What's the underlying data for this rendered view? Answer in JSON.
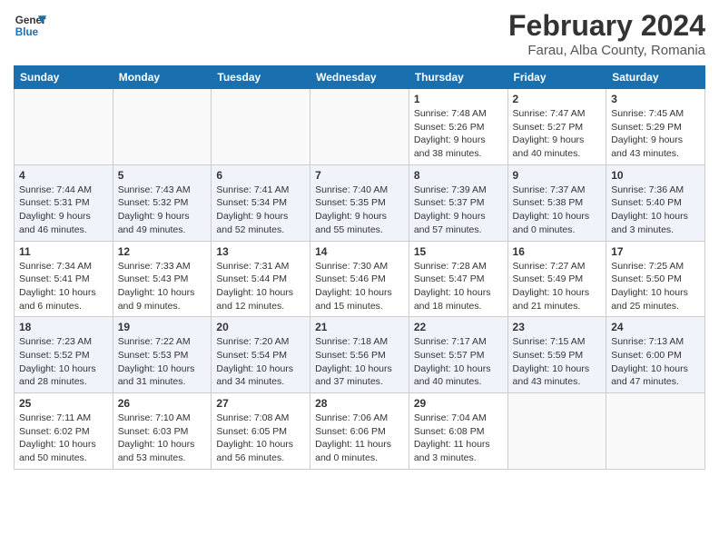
{
  "header": {
    "logo_line1": "General",
    "logo_line2": "Blue",
    "title": "February 2024",
    "subtitle": "Farau, Alba County, Romania"
  },
  "weekdays": [
    "Sunday",
    "Monday",
    "Tuesday",
    "Wednesday",
    "Thursday",
    "Friday",
    "Saturday"
  ],
  "weeks": [
    [
      {
        "num": "",
        "info": ""
      },
      {
        "num": "",
        "info": ""
      },
      {
        "num": "",
        "info": ""
      },
      {
        "num": "",
        "info": ""
      },
      {
        "num": "1",
        "info": "Sunrise: 7:48 AM\nSunset: 5:26 PM\nDaylight: 9 hours\nand 38 minutes."
      },
      {
        "num": "2",
        "info": "Sunrise: 7:47 AM\nSunset: 5:27 PM\nDaylight: 9 hours\nand 40 minutes."
      },
      {
        "num": "3",
        "info": "Sunrise: 7:45 AM\nSunset: 5:29 PM\nDaylight: 9 hours\nand 43 minutes."
      }
    ],
    [
      {
        "num": "4",
        "info": "Sunrise: 7:44 AM\nSunset: 5:31 PM\nDaylight: 9 hours\nand 46 minutes."
      },
      {
        "num": "5",
        "info": "Sunrise: 7:43 AM\nSunset: 5:32 PM\nDaylight: 9 hours\nand 49 minutes."
      },
      {
        "num": "6",
        "info": "Sunrise: 7:41 AM\nSunset: 5:34 PM\nDaylight: 9 hours\nand 52 minutes."
      },
      {
        "num": "7",
        "info": "Sunrise: 7:40 AM\nSunset: 5:35 PM\nDaylight: 9 hours\nand 55 minutes."
      },
      {
        "num": "8",
        "info": "Sunrise: 7:39 AM\nSunset: 5:37 PM\nDaylight: 9 hours\nand 57 minutes."
      },
      {
        "num": "9",
        "info": "Sunrise: 7:37 AM\nSunset: 5:38 PM\nDaylight: 10 hours\nand 0 minutes."
      },
      {
        "num": "10",
        "info": "Sunrise: 7:36 AM\nSunset: 5:40 PM\nDaylight: 10 hours\nand 3 minutes."
      }
    ],
    [
      {
        "num": "11",
        "info": "Sunrise: 7:34 AM\nSunset: 5:41 PM\nDaylight: 10 hours\nand 6 minutes."
      },
      {
        "num": "12",
        "info": "Sunrise: 7:33 AM\nSunset: 5:43 PM\nDaylight: 10 hours\nand 9 minutes."
      },
      {
        "num": "13",
        "info": "Sunrise: 7:31 AM\nSunset: 5:44 PM\nDaylight: 10 hours\nand 12 minutes."
      },
      {
        "num": "14",
        "info": "Sunrise: 7:30 AM\nSunset: 5:46 PM\nDaylight: 10 hours\nand 15 minutes."
      },
      {
        "num": "15",
        "info": "Sunrise: 7:28 AM\nSunset: 5:47 PM\nDaylight: 10 hours\nand 18 minutes."
      },
      {
        "num": "16",
        "info": "Sunrise: 7:27 AM\nSunset: 5:49 PM\nDaylight: 10 hours\nand 21 minutes."
      },
      {
        "num": "17",
        "info": "Sunrise: 7:25 AM\nSunset: 5:50 PM\nDaylight: 10 hours\nand 25 minutes."
      }
    ],
    [
      {
        "num": "18",
        "info": "Sunrise: 7:23 AM\nSunset: 5:52 PM\nDaylight: 10 hours\nand 28 minutes."
      },
      {
        "num": "19",
        "info": "Sunrise: 7:22 AM\nSunset: 5:53 PM\nDaylight: 10 hours\nand 31 minutes."
      },
      {
        "num": "20",
        "info": "Sunrise: 7:20 AM\nSunset: 5:54 PM\nDaylight: 10 hours\nand 34 minutes."
      },
      {
        "num": "21",
        "info": "Sunrise: 7:18 AM\nSunset: 5:56 PM\nDaylight: 10 hours\nand 37 minutes."
      },
      {
        "num": "22",
        "info": "Sunrise: 7:17 AM\nSunset: 5:57 PM\nDaylight: 10 hours\nand 40 minutes."
      },
      {
        "num": "23",
        "info": "Sunrise: 7:15 AM\nSunset: 5:59 PM\nDaylight: 10 hours\nand 43 minutes."
      },
      {
        "num": "24",
        "info": "Sunrise: 7:13 AM\nSunset: 6:00 PM\nDaylight: 10 hours\nand 47 minutes."
      }
    ],
    [
      {
        "num": "25",
        "info": "Sunrise: 7:11 AM\nSunset: 6:02 PM\nDaylight: 10 hours\nand 50 minutes."
      },
      {
        "num": "26",
        "info": "Sunrise: 7:10 AM\nSunset: 6:03 PM\nDaylight: 10 hours\nand 53 minutes."
      },
      {
        "num": "27",
        "info": "Sunrise: 7:08 AM\nSunset: 6:05 PM\nDaylight: 10 hours\nand 56 minutes."
      },
      {
        "num": "28",
        "info": "Sunrise: 7:06 AM\nSunset: 6:06 PM\nDaylight: 11 hours\nand 0 minutes."
      },
      {
        "num": "29",
        "info": "Sunrise: 7:04 AM\nSunset: 6:08 PM\nDaylight: 11 hours\nand 3 minutes."
      },
      {
        "num": "",
        "info": ""
      },
      {
        "num": "",
        "info": ""
      }
    ]
  ]
}
